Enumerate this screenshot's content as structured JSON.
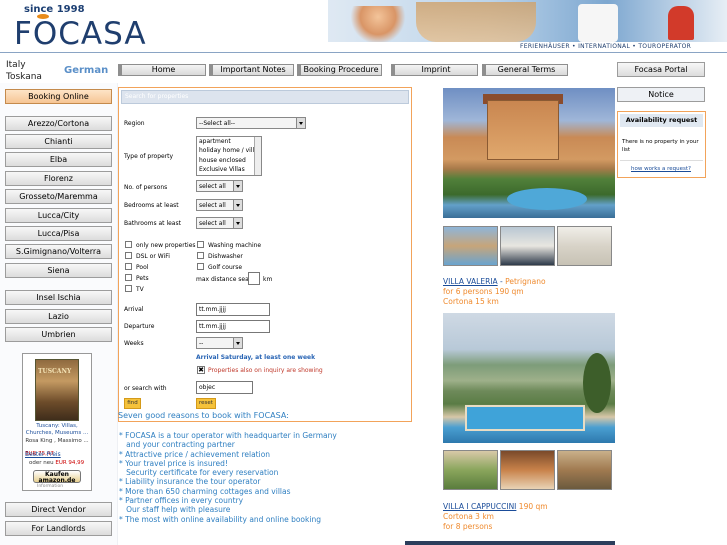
{
  "header": {
    "since": "since 1998",
    "logo_before": "F",
    "logo_o": "O",
    "logo_after": "CASA",
    "tagline": "FERIENHÄUSER • INTERNATIONAL • TOUROPERATOR"
  },
  "region_label": {
    "line1": "Italy",
    "line2": "Toskana"
  },
  "language": "German",
  "nav": [
    "Home",
    "Important Notes",
    "Booking Procedure",
    "Imprint",
    "General Terms"
  ],
  "portal_button": "Focasa Portal",
  "notice_button": "Notice",
  "sidebar": {
    "booking_online": "Booking Online",
    "regions": [
      "Arezzo/Cortona",
      "Chianti",
      "Elba",
      "Florenz",
      "Grosseto/Maremma",
      "Lucca/City",
      "Lucca/Pisa",
      "S.Gimignano/Volterra",
      "Siena"
    ],
    "other_regions": [
      "Insel Ischia",
      "Lazio",
      "Umbrien"
    ],
    "bottom": [
      "Direct Vendor",
      "For Landlords"
    ]
  },
  "ad": {
    "cover_text": "TUSCANY",
    "title": "Tuscany: Villas, Churches, Museums ...",
    "author": "Rosa King , Massimo ...",
    "price_label": "Bester Preis",
    "price": "EUR 75,47",
    "alt_label": "oder neu",
    "alt_price": "EUR 94,99",
    "button": "Kaufen amazon.de",
    "info": "Information"
  },
  "search": {
    "heading": "Search for properties",
    "region_label": "Region",
    "region_value": "--Select all--",
    "type_label": "Type of property",
    "types": [
      "apartment",
      "holiday home / villa",
      "house enclosed",
      "Exclusive Villas"
    ],
    "persons_label": "No. of persons",
    "persons_value": "select all",
    "bedrooms_label": "Bedrooms at least",
    "bedrooms_value": "select all",
    "bathrooms_label": "Bathrooms at least",
    "bathrooms_value": "select all",
    "checks": [
      "only new properties",
      "DSL or WiFi",
      "Pool",
      "Pets",
      "TV"
    ],
    "checks_right": [
      "Washing machine",
      "Dishwasher",
      "Golf course"
    ],
    "distance_label": "max distance sea",
    "distance_unit": "km",
    "arrival_label": "Arrival",
    "arrival_value": "tt.mm.jjjj",
    "departure_label": "Departure",
    "departure_value": "tt.mm.jjjj",
    "weeks_label": "Weeks",
    "weeks_value": "--",
    "arrival_note": "Arrival Saturday, at least one week",
    "inquiry_note": "Properties also on inquiry are showing",
    "or_search_label": "or search with",
    "objec_value": "objec",
    "find_button": "find",
    "reset_button": "reset"
  },
  "reasons": {
    "title": "Seven good reasons to book with FOCASA:",
    "items": [
      "* FOCASA is a tour operator with headquarter in Germany",
      "   and your contracting partner",
      "* Attractive price / achievement relation",
      "* Your travel price is insured!",
      "   Security certificate for every reservation",
      "* Liability insurance the tour operator",
      "* More than 650 charming cottages and villas",
      "* Partner offices in every country",
      "   Our staff help with pleasure",
      "* The most with online availability and online booking"
    ]
  },
  "listings": [
    {
      "name": "VILLA VALERIA",
      "place": "Petrignano",
      "line2": "for 6 persons 190 qm",
      "line3": "Cortona 15 km"
    },
    {
      "name": "VILLA I CAPPUCCINI",
      "place": "190 qm",
      "line2": "Cortona 3 km",
      "line3": "for 8 persons"
    }
  ],
  "availability": {
    "heading": "Availability request",
    "message": "There is no property in your list",
    "link": "how works a request?"
  }
}
